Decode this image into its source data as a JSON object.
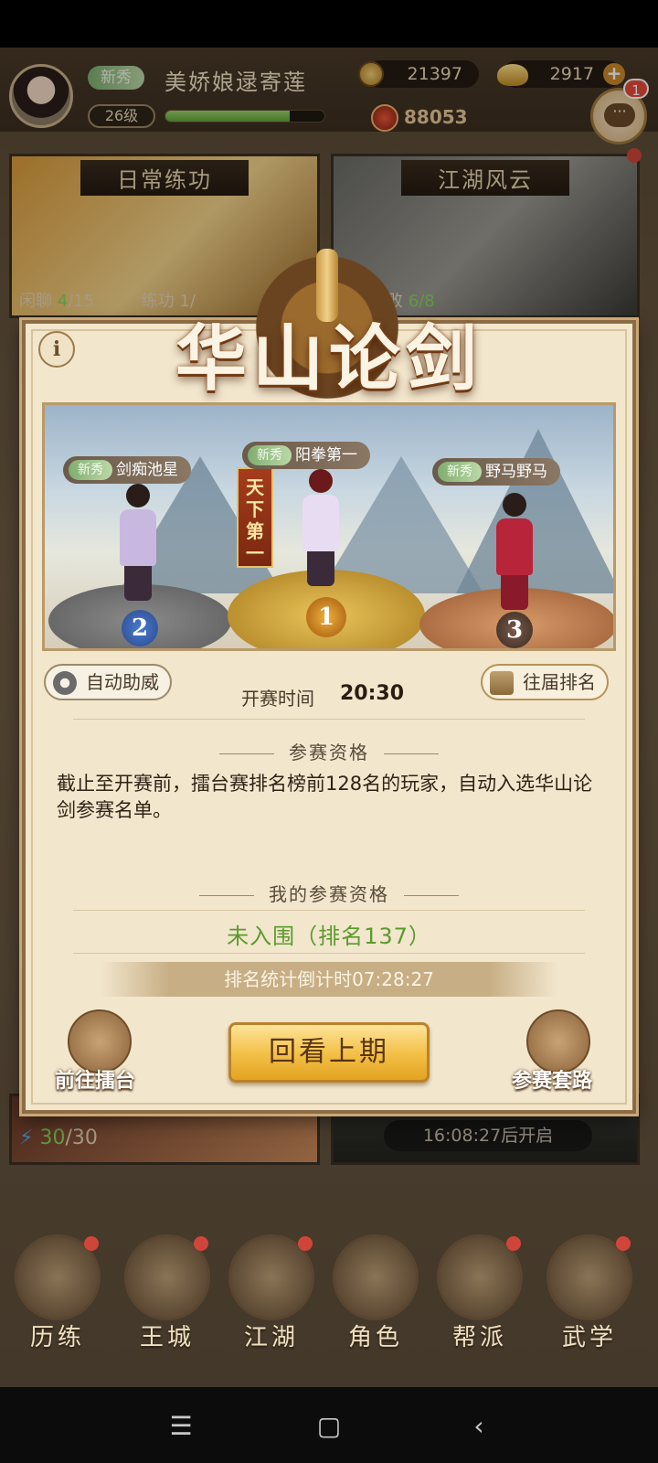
{
  "player": {
    "tag": "新秀",
    "name": "美娇娘逯寄莲",
    "level": "26级",
    "exp_fraction": 0.78,
    "coins": "21397",
    "ingots": "2917",
    "power": "88053",
    "chat_badge": "1"
  },
  "cards": {
    "daily": {
      "title": "日常练功",
      "chat_label": "闲聊",
      "chat_current": "4",
      "chat_total": "/15",
      "practice_label": "练功 1/"
    },
    "jianghu": {
      "title": "江湖风云",
      "defeat_label": "次败",
      "defeat_count": "6/8"
    },
    "energy": {
      "current": "30",
      "total": "/30"
    },
    "locked": {
      "countdown": "16:08:27后开启"
    }
  },
  "modal": {
    "title": "华山论剑",
    "banner": "天下第一",
    "podium": [
      {
        "rank": "2",
        "tag": "新秀",
        "name": "剑痴池星"
      },
      {
        "rank": "1",
        "tag": "新秀",
        "name": "阳拳第一"
      },
      {
        "rank": "3",
        "tag": "新秀",
        "name": "野马野马"
      }
    ],
    "auto_cheer": "自动助威",
    "start_time_label": "开赛时间",
    "start_time": "20:30",
    "past_rankings": "往届排名",
    "qual_title": "参赛资格",
    "qual_desc": "截止至开赛前，擂台赛排名榜前128名的玩家，自动入选华山论剑参赛名单。",
    "my_qual_title": "我的参赛资格",
    "my_status": "未入围（排名137）",
    "countdown": "排名统计倒计时07:28:27",
    "goto_arena": "前往擂台",
    "review_last": "回看上期",
    "routines": "参赛套路"
  },
  "nav": {
    "items": [
      "历练",
      "王城",
      "江湖",
      "角色",
      "帮派",
      "武学"
    ]
  },
  "colors": {
    "accent_gold": "#f4c24a",
    "status_green": "#5c9a2e",
    "badge_red": "#e64a3a"
  }
}
